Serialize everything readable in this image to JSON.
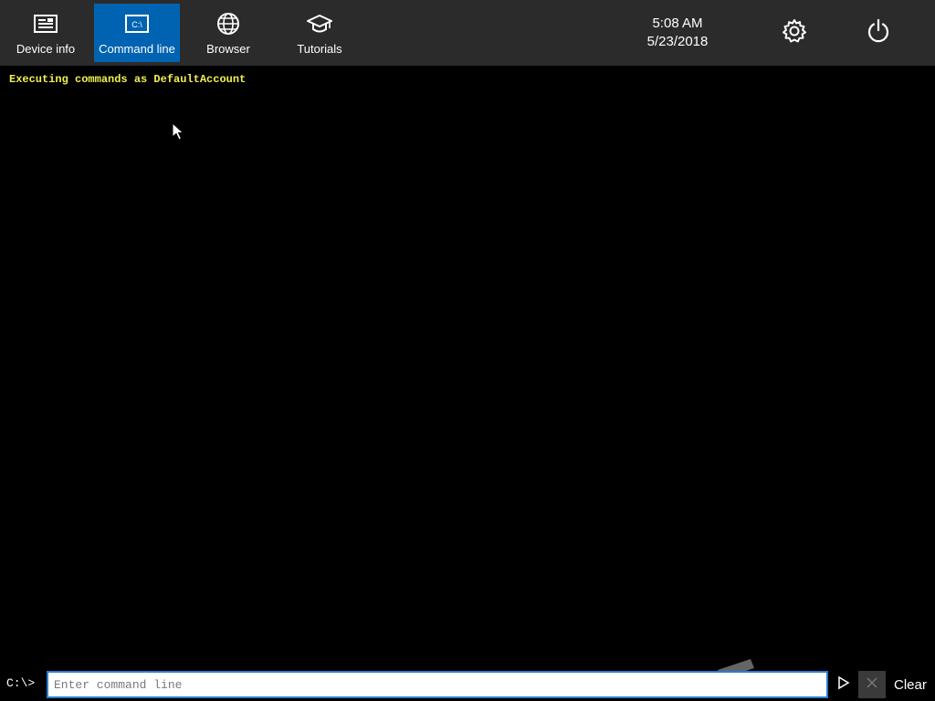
{
  "nav": {
    "items": [
      {
        "label": "Device info",
        "icon": "device-info-icon",
        "active": false
      },
      {
        "label": "Command line",
        "icon": "command-prompt-icon",
        "active": true
      },
      {
        "label": "Browser",
        "icon": "globe-icon",
        "active": false
      },
      {
        "label": "Tutorials",
        "icon": "graduation-cap-icon",
        "active": false
      }
    ]
  },
  "clock": {
    "time": "5:08 AM",
    "date": "5/23/2018"
  },
  "top_icons": [
    "gear-icon",
    "power-icon"
  ],
  "console": {
    "lines": [
      "Executing commands as DefaultAccount"
    ],
    "line_color": "#f0f050"
  },
  "command": {
    "prompt": "C:\\>",
    "placeholder": "Enter command line",
    "value": "",
    "clear_label": "Clear"
  },
  "colors": {
    "topbar": "#2b2b2b",
    "accent": "#0063b1",
    "background": "#000000"
  }
}
